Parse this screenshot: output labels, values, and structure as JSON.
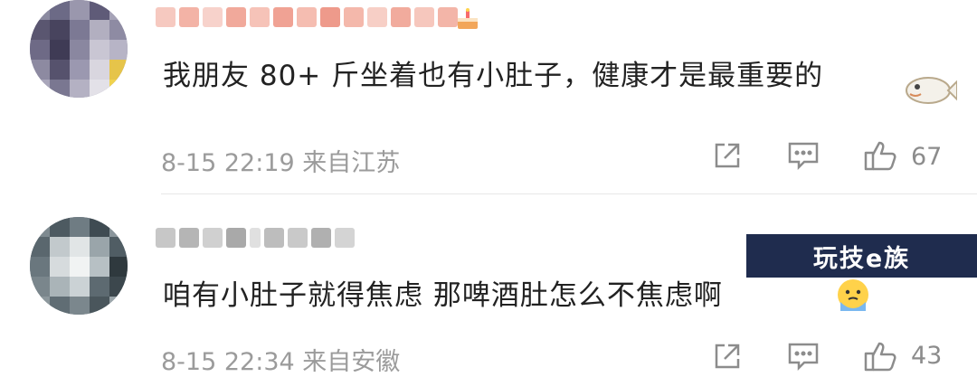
{
  "comments": [
    {
      "username": "(blurred username)",
      "text": "我朋友 80+ 斤坐着也有小肚子，健康才是最重要的",
      "date_time": "8-15 22:19",
      "location": "来自江苏",
      "likes": "67",
      "emoji_after_name": "cake-emoji",
      "emoji_after_text": "fish-emoji"
    },
    {
      "username": "(blurred username)",
      "text": "咱有小肚子就得焦虑 那啤酒肚怎么不焦虑啊",
      "date_time": "8-15 22:34",
      "location": "来自安徽",
      "likes": "43",
      "emoji_after_text": "worried-face-emoji"
    }
  ],
  "actions": {
    "share_icon": "share-icon",
    "reply_icon": "comment-icon",
    "like_icon": "thumbs-up-icon"
  },
  "watermark": "玩技e族",
  "colors": {
    "text": "#222222",
    "meta": "#9b9b9b",
    "watermark_bg": "#1f2c4e"
  }
}
